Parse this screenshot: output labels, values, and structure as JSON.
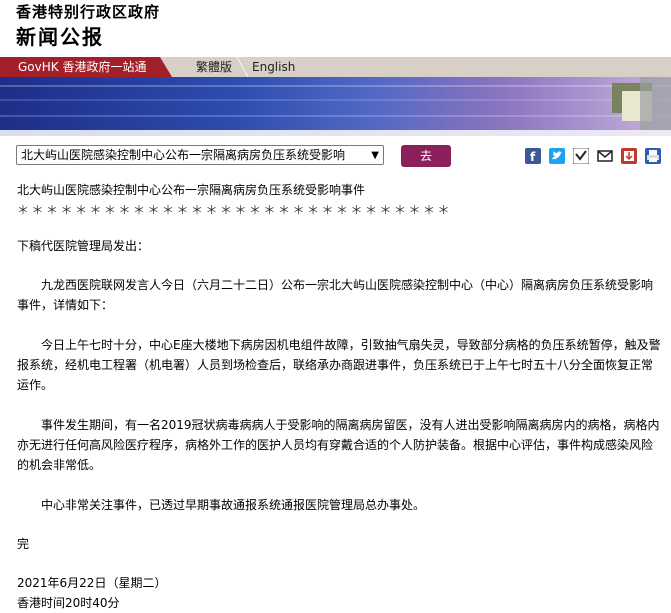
{
  "header": {
    "gov_name": "香港特别行政区政府",
    "press_release": "新闻公报"
  },
  "tabs": {
    "govhk": "GovHK 香港政府一站通",
    "traditional": "繁體版",
    "english": "English"
  },
  "toolbar": {
    "select_value": "北大屿山医院感染控制中心公布一宗隔离病房负压系统受影响",
    "go_label": "去",
    "icons": [
      "facebook-icon",
      "twitter-icon",
      "weibo-icon",
      "email-icon",
      "download-icon",
      "print-icon"
    ]
  },
  "article": {
    "title": "北大屿山医院感染控制中心公布一宗隔离病房负压系统受影响事件",
    "stars": "＊＊＊＊＊＊＊＊＊＊＊＊＊＊＊＊＊＊＊＊＊＊＊＊＊＊＊＊＊＊",
    "source": "下稿代医院管理局发出：",
    "para1": "九龙西医院联网发言人今日（六月二十二日）公布一宗北大屿山医院感染控制中心（中心）隔离病房负压系统受影响事件，详情如下：",
    "para2": "今日上午七时十分，中心E座大楼地下病房因机电组件故障，引致抽气扇失灵，导致部分病格的负压系统暂停，触及警报系统，经机电工程署（机电署）人员到场检查后，联络承办商跟进事件，负压系统已于上午七时五十八分全面恢复正常运作。",
    "para3": "事件发生期间，有一名2019冠状病毒病病人于受影响的隔离病房留医，没有人进出受影响隔离病房内的病格，病格内亦无进行任何高风险医疗程序，病格外工作的医护人员均有穿戴合适的个人防护装备。根据中心评估，事件构成感染风险的机会非常低。",
    "para4": "中心非常关注事件，已透过早期事故通报系统通报医院管理局总办事处。",
    "end": "完",
    "date": "2021年6月22日（星期二）",
    "time": "香港时间20时40分"
  }
}
